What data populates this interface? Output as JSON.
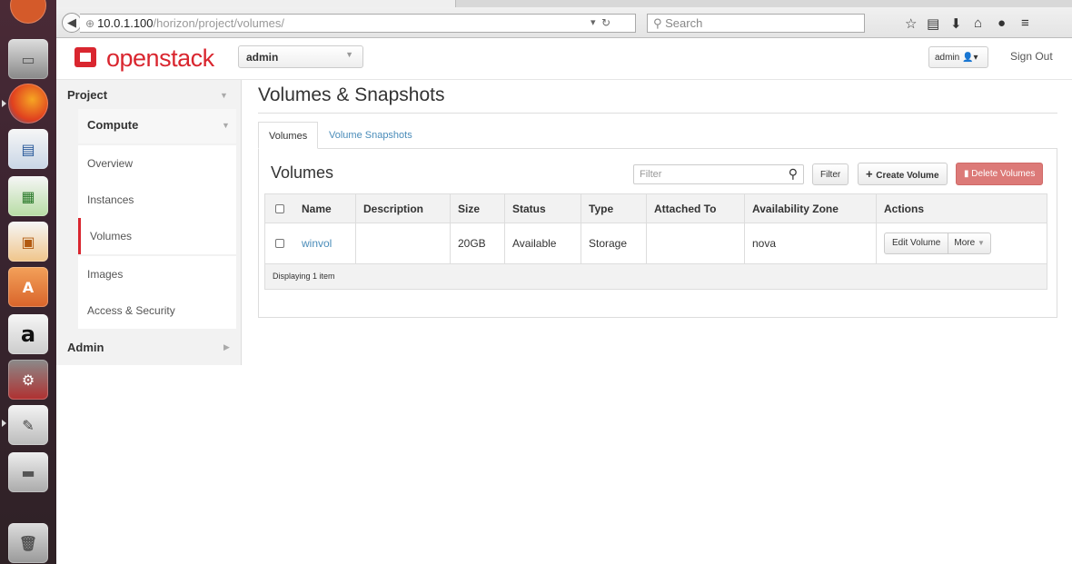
{
  "browser": {
    "url_host": "10.0.1.100",
    "url_path": "/horizon/project/volumes/",
    "search_placeholder": "Search"
  },
  "header": {
    "logo_text": "openstack",
    "project": "admin",
    "user": "admin",
    "signout": "Sign Out"
  },
  "sidebar": {
    "project_label": "Project",
    "compute_label": "Compute",
    "items": [
      {
        "label": "Overview"
      },
      {
        "label": "Instances"
      },
      {
        "label": "Volumes"
      },
      {
        "label": "Images"
      },
      {
        "label": "Access & Security"
      }
    ],
    "admin_label": "Admin"
  },
  "main": {
    "title": "Volumes & Snapshots",
    "tabs": [
      {
        "label": "Volumes"
      },
      {
        "label": "Volume Snapshots"
      }
    ],
    "section_title": "Volumes",
    "filter_placeholder": "Filter",
    "filter_button": "Filter",
    "create_button": "Create Volume",
    "delete_button": "Delete Volumes"
  },
  "table": {
    "columns": [
      "Name",
      "Description",
      "Size",
      "Status",
      "Type",
      "Attached To",
      "Availability Zone",
      "Actions"
    ],
    "rows": [
      {
        "name": "winvol",
        "description": "",
        "size": "20GB",
        "status": "Available",
        "type": "Storage",
        "attached_to": "",
        "zone": "nova",
        "edit_label": "Edit Volume",
        "more_label": "More"
      }
    ],
    "footer": "Displaying 1 item"
  },
  "colors": {
    "brand": "#d9262f",
    "link": "#4a8cb9",
    "danger": "#dc7a78"
  }
}
